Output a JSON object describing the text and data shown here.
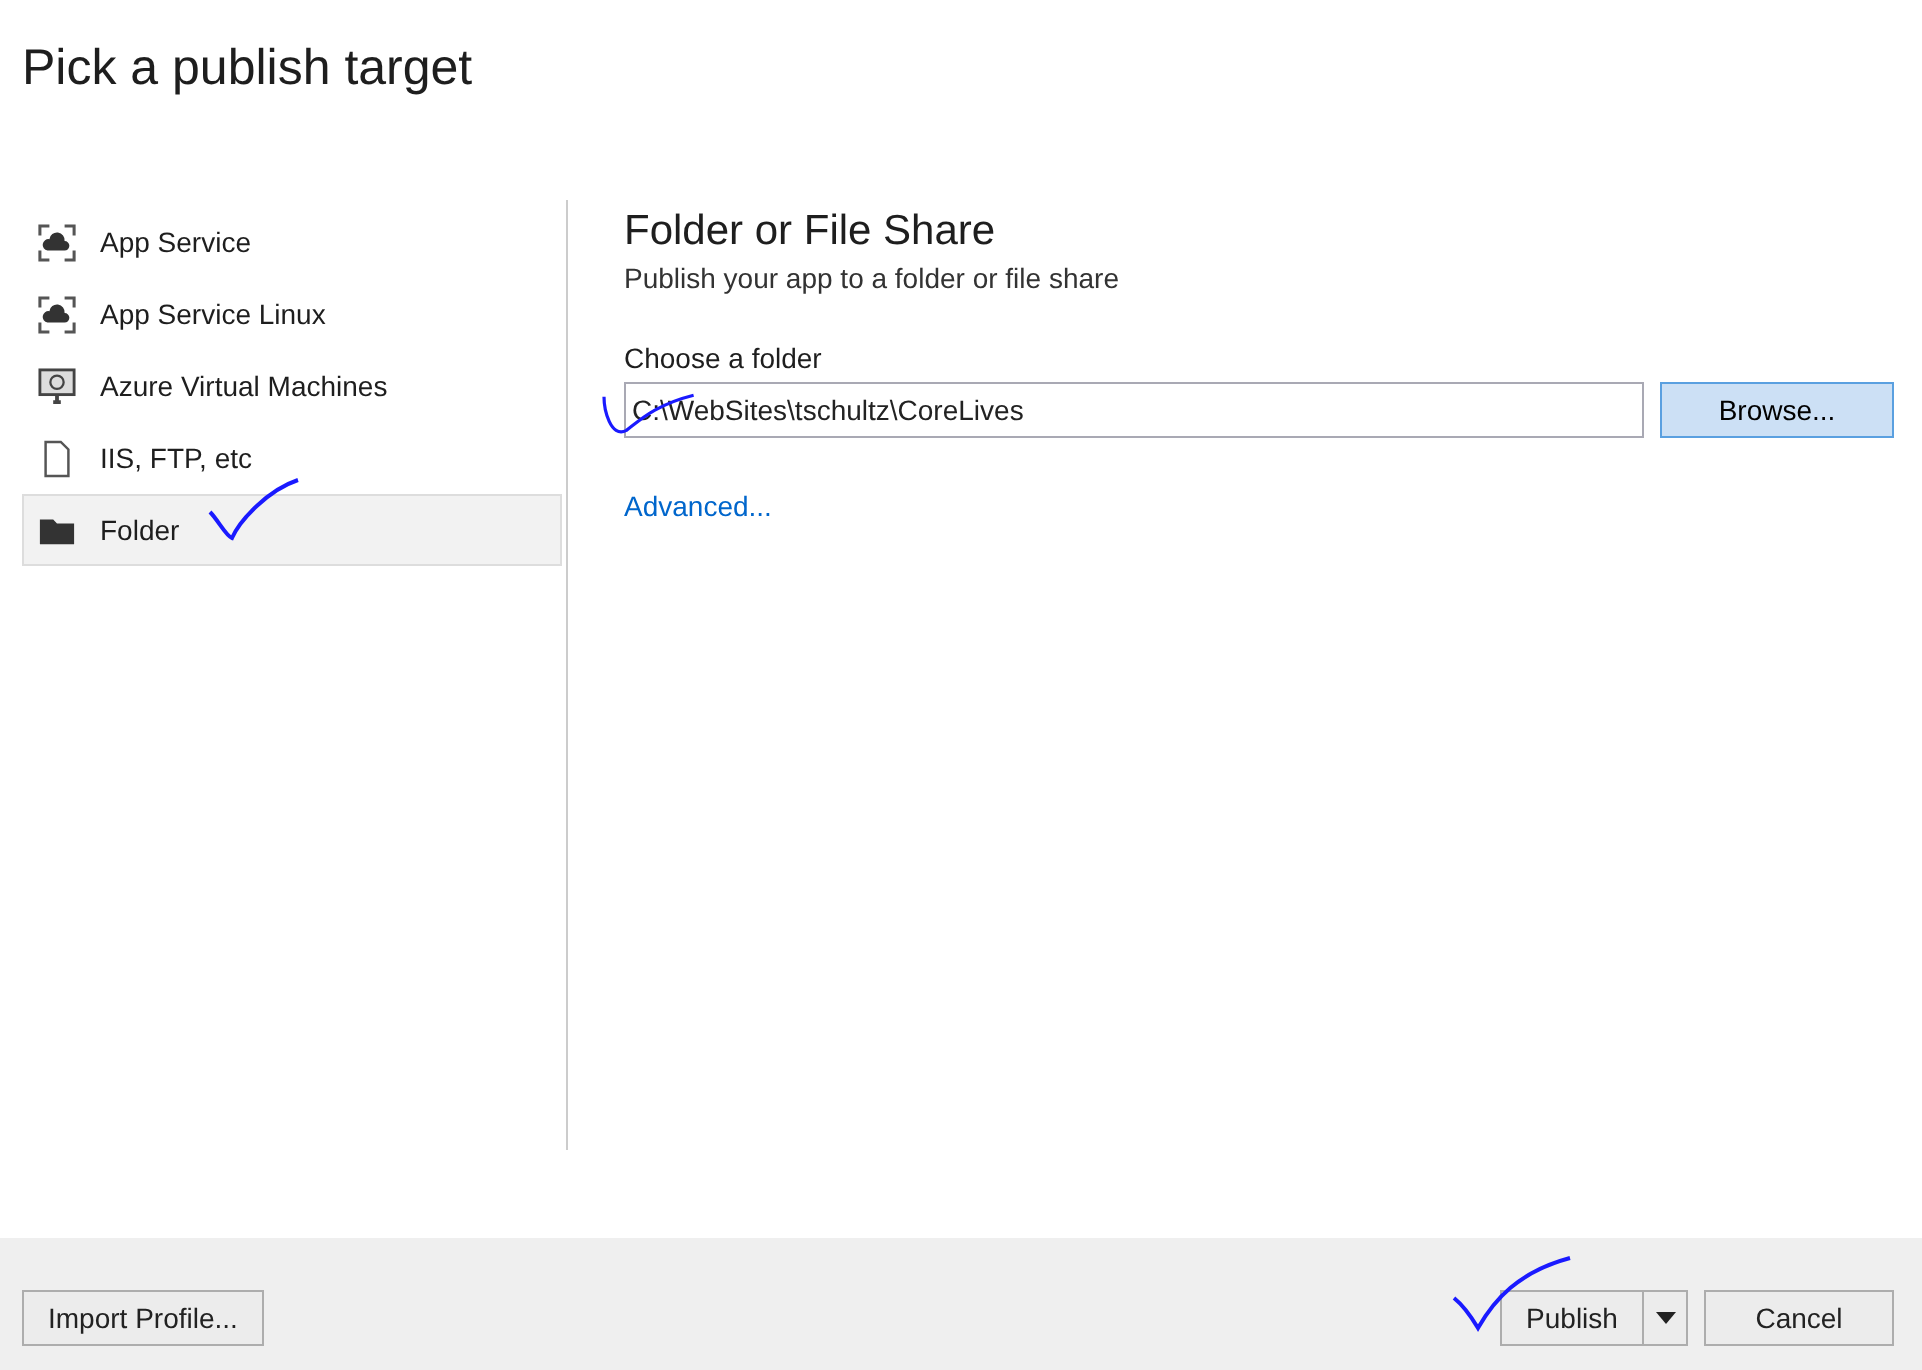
{
  "title": "Pick a publish target",
  "targets": [
    {
      "label": "App Service",
      "kind": "cloud",
      "selected": false
    },
    {
      "label": "App Service Linux",
      "kind": "cloud",
      "selected": false
    },
    {
      "label": "Azure Virtual Machines",
      "kind": "vm",
      "selected": false
    },
    {
      "label": "IIS, FTP, etc",
      "kind": "file",
      "selected": false
    },
    {
      "label": "Folder",
      "kind": "folder",
      "selected": true
    }
  ],
  "panel": {
    "heading": "Folder or File Share",
    "description": "Publish your app to a folder or file share",
    "field_label": "Choose a folder",
    "field_value": "C:\\WebSites\\tschultz\\CoreLives",
    "browse": "Browse...",
    "advanced": "Advanced..."
  },
  "footer": {
    "import": "Import Profile...",
    "publish": "Publish",
    "cancel": "Cancel"
  }
}
